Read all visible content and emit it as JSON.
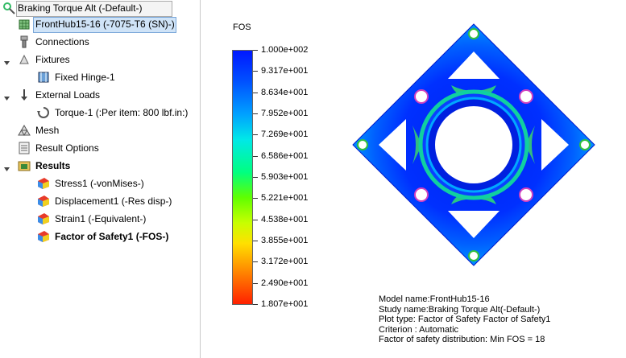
{
  "tree": {
    "study": "Braking Torque Alt (-Default-)",
    "part": "FrontHub15-16 (-7075-T6 (SN)-)",
    "connections": "Connections",
    "fixtures": "Fixtures",
    "fixture_item": "Fixed Hinge-1",
    "external_loads": "External Loads",
    "load_item": "Torque-1 (:Per item: 800 lbf.in:)",
    "mesh": "Mesh",
    "result_options": "Result Options",
    "results": "Results",
    "result_items": [
      {
        "label": "Stress1 (-vonMises-)"
      },
      {
        "label": "Displacement1 (-Res disp-)"
      },
      {
        "label": "Strain1 (-Equivalent-)"
      },
      {
        "label": "Factor of Safety1 (-FOS-)"
      }
    ]
  },
  "legend": {
    "title": "FOS",
    "labels": [
      "1.000e+002",
      "9.317e+001",
      "8.634e+001",
      "7.952e+001",
      "7.269e+001",
      "6.586e+001",
      "5.903e+001",
      "5.221e+001",
      "4.538e+001",
      "3.855e+001",
      "3.172e+001",
      "2.490e+001",
      "1.807e+001"
    ]
  },
  "info": {
    "model_name": "Model name:FrontHub15-16",
    "study_name": "Study name:Braking Torque Alt(-Default-)",
    "plot_type": "Plot type: Factor of Safety Factor of Safety1",
    "criterion": "Criterion : Automatic",
    "distribution": "Factor of safety distribution: Min FOS = 18"
  },
  "colors": {
    "selection": "#cfe3f7",
    "fos_max": "#0018ff",
    "fos_min": "#ff2000"
  },
  "icons": [
    "study-icon",
    "part-icon",
    "connections-icon",
    "fixtures-icon",
    "fixed-hinge-icon",
    "external-loads-icon",
    "torque-icon",
    "mesh-icon",
    "result-options-icon",
    "results-folder-icon",
    "stress-plot-icon",
    "displacement-plot-icon",
    "strain-plot-icon",
    "fos-plot-icon"
  ]
}
